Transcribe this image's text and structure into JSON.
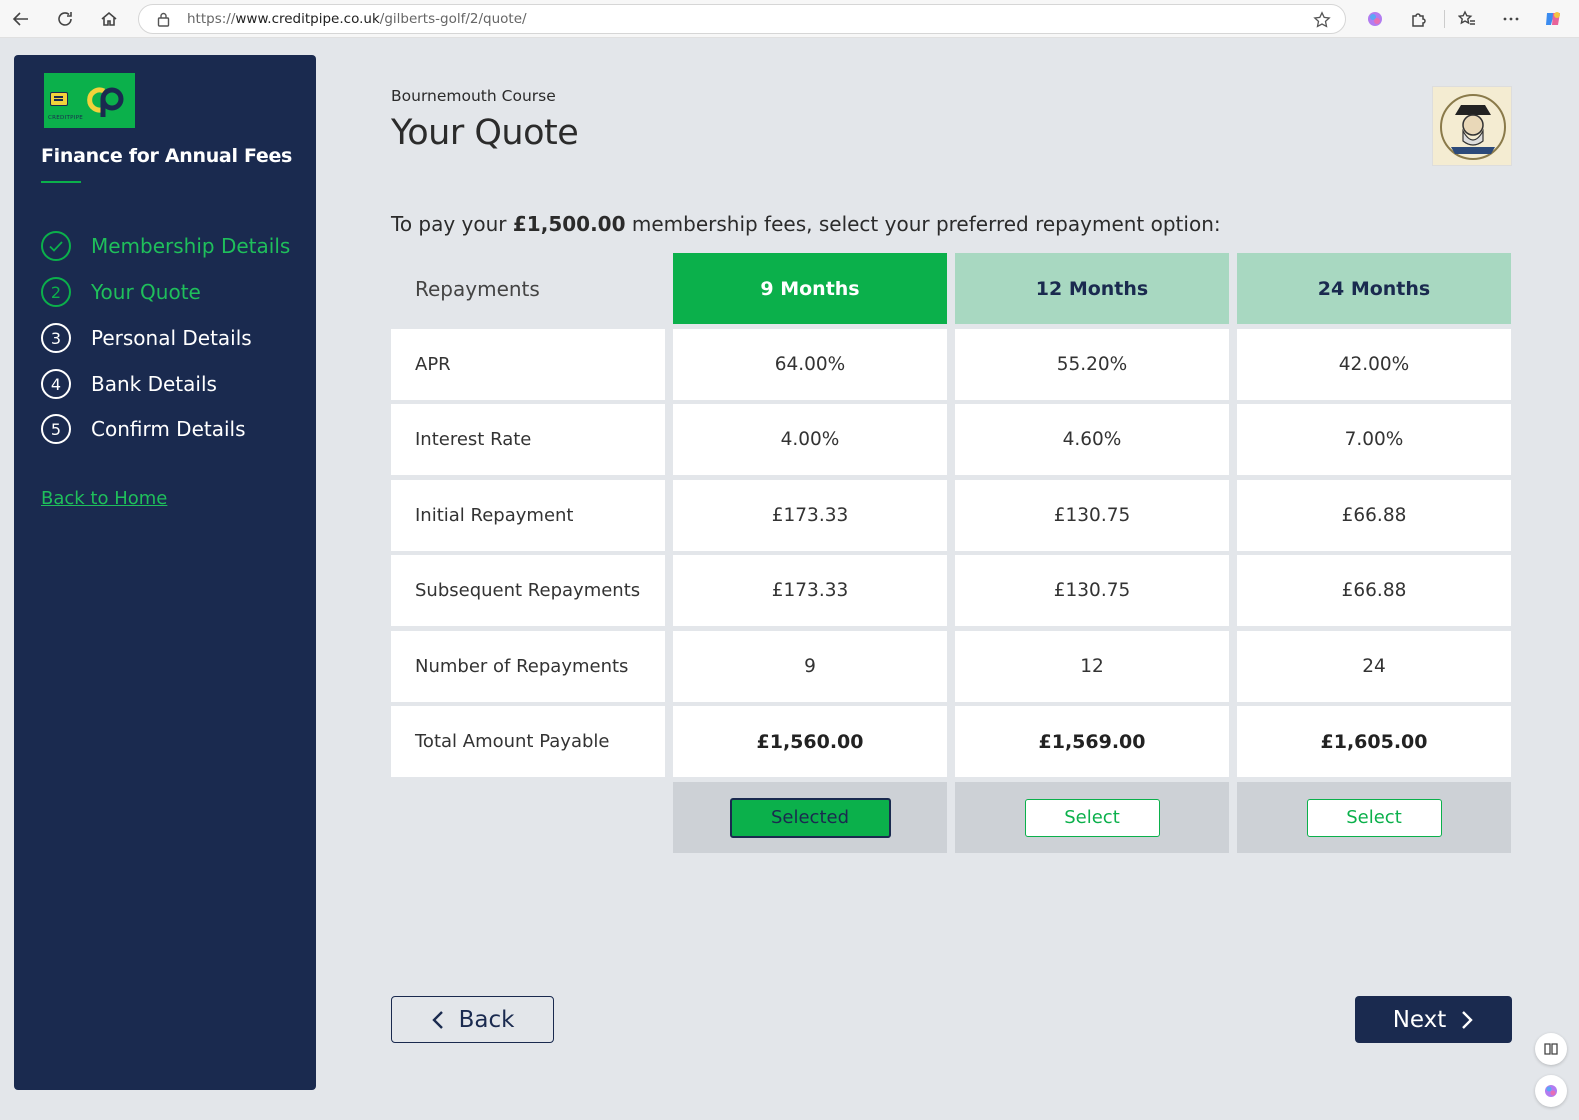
{
  "browser": {
    "url_prefix": "https://",
    "url_host": "www.creditpipe.co.uk",
    "url_path": "/gilberts-golf/2/quote/"
  },
  "sidebar": {
    "logo_text": "CREDITPIPE",
    "title": "Finance for Annual Fees",
    "steps": [
      {
        "number": "✓",
        "label": "Membership Details",
        "state": "done"
      },
      {
        "number": "2",
        "label": "Your Quote",
        "state": "active"
      },
      {
        "number": "3",
        "label": "Personal Details",
        "state": "pending"
      },
      {
        "number": "4",
        "label": "Bank Details",
        "state": "pending"
      },
      {
        "number": "5",
        "label": "Confirm Details",
        "state": "pending"
      }
    ],
    "back_home": "Back to Home"
  },
  "main": {
    "course": "Bournemouth Course",
    "title": "Your Quote",
    "intro_before": "To pay your ",
    "intro_amount": "£1,500.00",
    "intro_after": " membership fees, select your preferred repayment option:"
  },
  "table": {
    "header_label": "Repayments",
    "columns": [
      "9 Months",
      "12 Months",
      "24 Months"
    ],
    "rows": [
      {
        "label": "APR",
        "values": [
          "64.00%",
          "55.20%",
          "42.00%"
        ]
      },
      {
        "label": "Interest Rate",
        "values": [
          "4.00%",
          "4.60%",
          "7.00%"
        ]
      },
      {
        "label": "Initial Repayment",
        "values": [
          "£173.33",
          "£130.75",
          "£66.88"
        ]
      },
      {
        "label": "Subsequent Repayments",
        "values": [
          "£173.33",
          "£130.75",
          "£66.88"
        ]
      },
      {
        "label": "Number of Repayments",
        "values": [
          "9",
          "12",
          "24"
        ]
      },
      {
        "label": "Total Amount Payable",
        "values": [
          "£1,560.00",
          "£1,569.00",
          "£1,605.00"
        ]
      }
    ],
    "buttons": [
      "Selected",
      "Select",
      "Select"
    ],
    "selected_index": 0
  },
  "actions": {
    "back": "Back",
    "next": "Next"
  },
  "colors": {
    "navy": "#1a2a4f",
    "green": "#0bb04b",
    "light_green": "#a8d8c1",
    "background": "#e3e6ea"
  }
}
